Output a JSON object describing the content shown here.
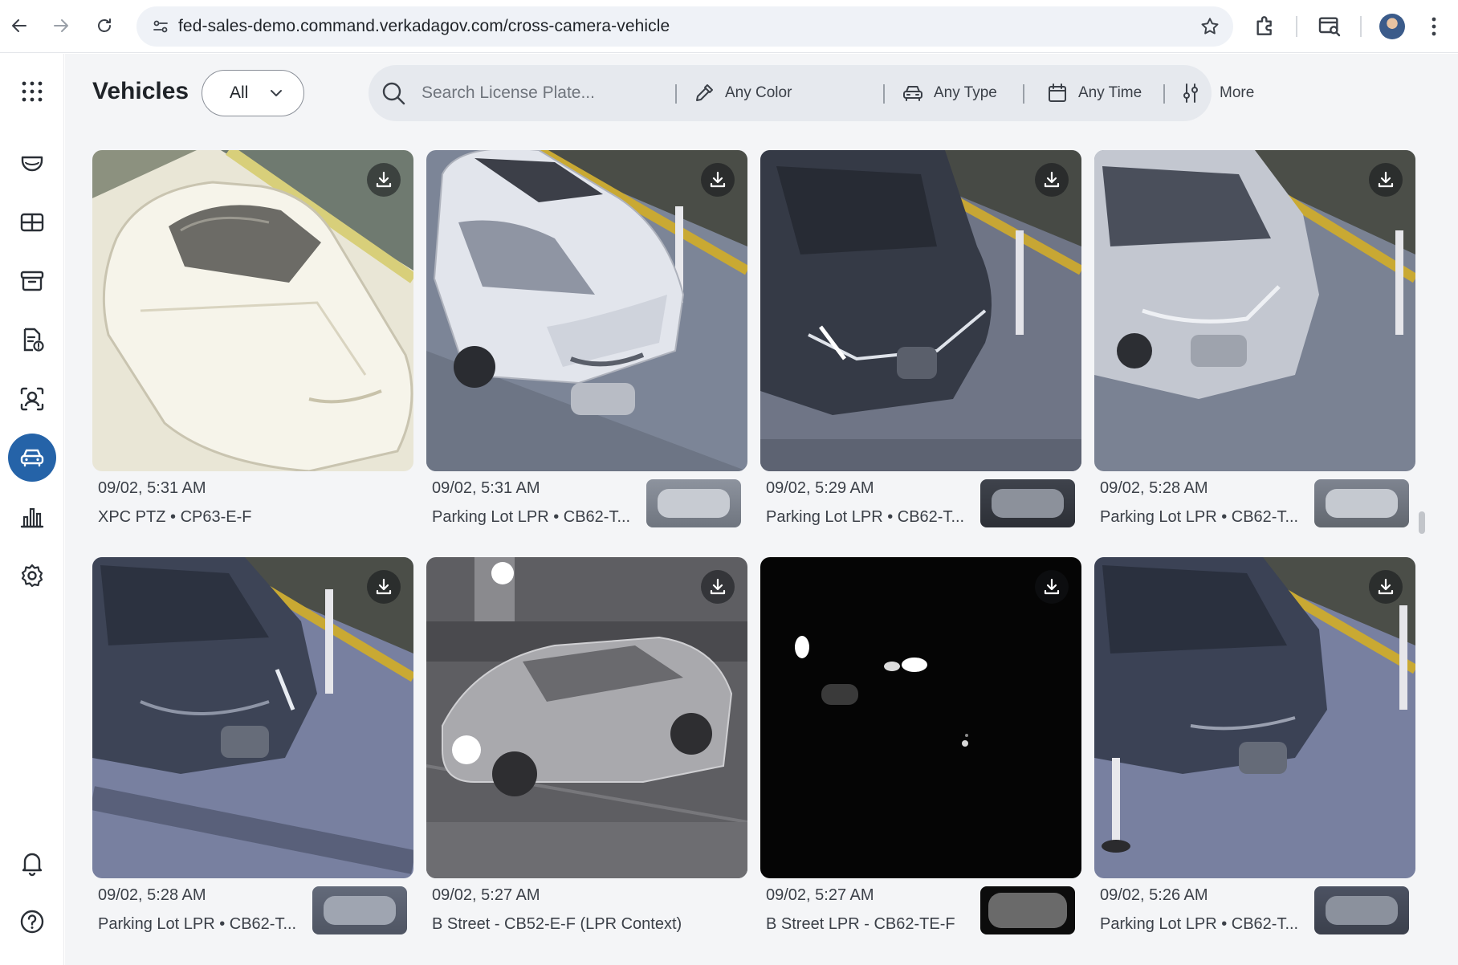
{
  "browser": {
    "url": "fed-sales-demo.command.verkadagov.com/cross-camera-vehicle"
  },
  "header": {
    "title": "Vehicles",
    "scope_filter": "All"
  },
  "search": {
    "placeholder": "Search License Plate...",
    "color_filter": "Any Color",
    "type_filter": "Any Type",
    "time_filter": "Any Time",
    "more_filter": "More"
  },
  "rail": {
    "items": [
      {
        "icon": "apps-grid-icon"
      },
      {
        "icon": "camera-dome-icon"
      },
      {
        "icon": "floorplan-grid-icon"
      },
      {
        "icon": "archive-box-icon"
      },
      {
        "icon": "report-document-icon"
      },
      {
        "icon": "person-search-icon"
      },
      {
        "icon": "vehicle-icon",
        "active": true
      },
      {
        "icon": "analytics-chart-icon"
      },
      {
        "icon": "settings-gear-icon"
      },
      {
        "icon": "notifications-bell-icon"
      },
      {
        "icon": "help-icon"
      }
    ]
  },
  "colors": {
    "accent": "#2563a8",
    "search_bg": "#e6e9ee",
    "page_bg": "#f4f5f7"
  },
  "results": [
    {
      "time": "09/02, 5:31 AM",
      "camera": "XPC PTZ • CP63-E-F",
      "scene": "white-sedan-overexposed",
      "plate": false
    },
    {
      "time": "09/02, 5:31 AM",
      "camera": "Parking Lot LPR • CB62-T...",
      "scene": "white-suv",
      "plate": true
    },
    {
      "time": "09/02, 5:29 AM",
      "camera": "Parking Lot LPR • CB62-T...",
      "scene": "dark-sedan",
      "plate": true
    },
    {
      "time": "09/02, 5:28 AM",
      "camera": "Parking Lot LPR • CB62-T...",
      "scene": "silver-sedan",
      "plate": true
    },
    {
      "time": "09/02, 5:28 AM",
      "camera": "Parking Lot LPR • CB62-T...",
      "scene": "dark-sedan-2",
      "plate": true
    },
    {
      "time": "09/02, 5:27 AM",
      "camera": "B Street - CB52-E-F (LPR Context)",
      "scene": "night-street",
      "plate": false
    },
    {
      "time": "09/02, 5:27 AM",
      "camera": "B Street LPR - CB62-TE-F",
      "scene": "night-dark",
      "plate": true
    },
    {
      "time": "09/02, 5:26 AM",
      "camera": "Parking Lot LPR • CB62-T...",
      "scene": "dark-sedan-3",
      "plate": true
    }
  ]
}
